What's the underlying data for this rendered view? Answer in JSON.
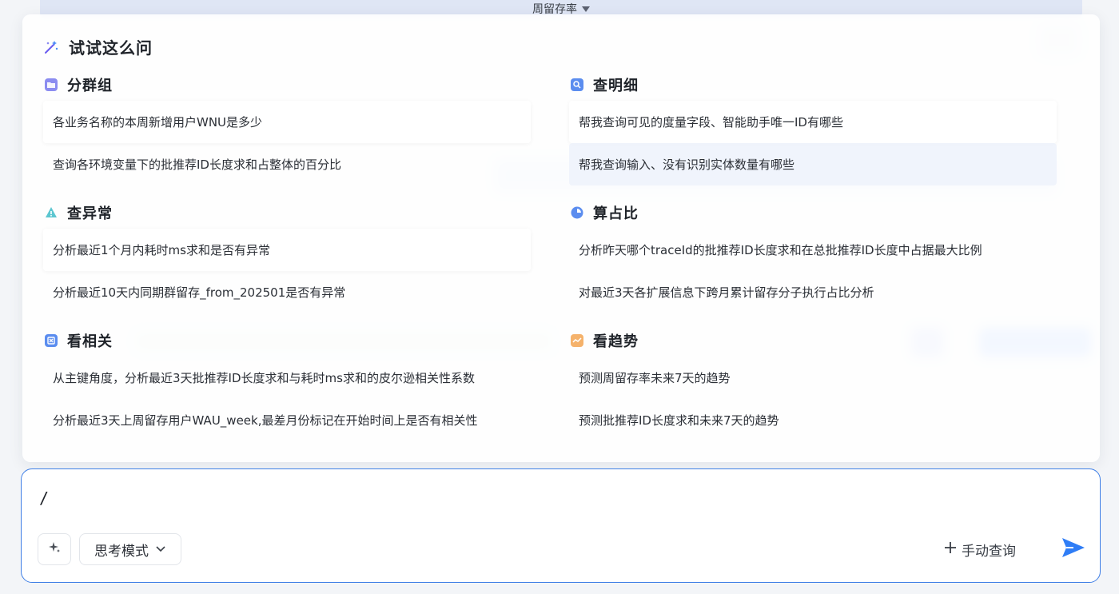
{
  "background": {
    "topbar_label": "周留存率"
  },
  "panel": {
    "title": "试试这么问",
    "groups": [
      {
        "label": "分群组",
        "icon": "folder-icon",
        "items": [
          "各业务名称的本周新增用户WNU是多少",
          "查询各环境变量下的批推荐ID长度求和占整体的百分比"
        ]
      },
      {
        "label": "查明细",
        "icon": "magnifier-icon",
        "items": [
          "帮我查询可见的度量字段、智能助手唯一ID有哪些",
          "帮我查询输入、没有识别实体数量有哪些"
        ]
      },
      {
        "label": "查异常",
        "icon": "warning-icon",
        "items": [
          "分析最近1个月内耗时ms求和是否有异常",
          "分析最近10天内同期群留存_from_202501是否有异常"
        ]
      },
      {
        "label": "算占比",
        "icon": "pie-chart-icon",
        "items": [
          "分析昨天哪个traceId的批推荐ID长度求和在总批推荐ID长度中占据最大比例",
          "对最近3天各扩展信息下跨月累计留存分子执行占比分析"
        ]
      },
      {
        "label": "看相关",
        "icon": "correlation-icon",
        "items": [
          "从主键角度，分析最近3天批推荐ID长度求和与耗时ms求和的皮尔逊相关性系数",
          "分析最近3天上周留存用户WAU_week,最差月份标记在开始时间上是否有相关性"
        ]
      },
      {
        "label": "看趋势",
        "icon": "trend-icon",
        "items": [
          "预测周留存率未来7天的趋势",
          "预测批推荐ID长度求和未来7天的趋势"
        ]
      }
    ]
  },
  "composer": {
    "input_value": "/",
    "mode_label": "思考模式",
    "manual_label": "手动查询"
  },
  "colors": {
    "accent": "#3f7fe6",
    "send": "#2f7df6",
    "icon_purple": "#8b8cf0",
    "icon_blue": "#5b8def",
    "icon_teal": "#5cc6d0",
    "icon_orange": "#f5b26b"
  }
}
